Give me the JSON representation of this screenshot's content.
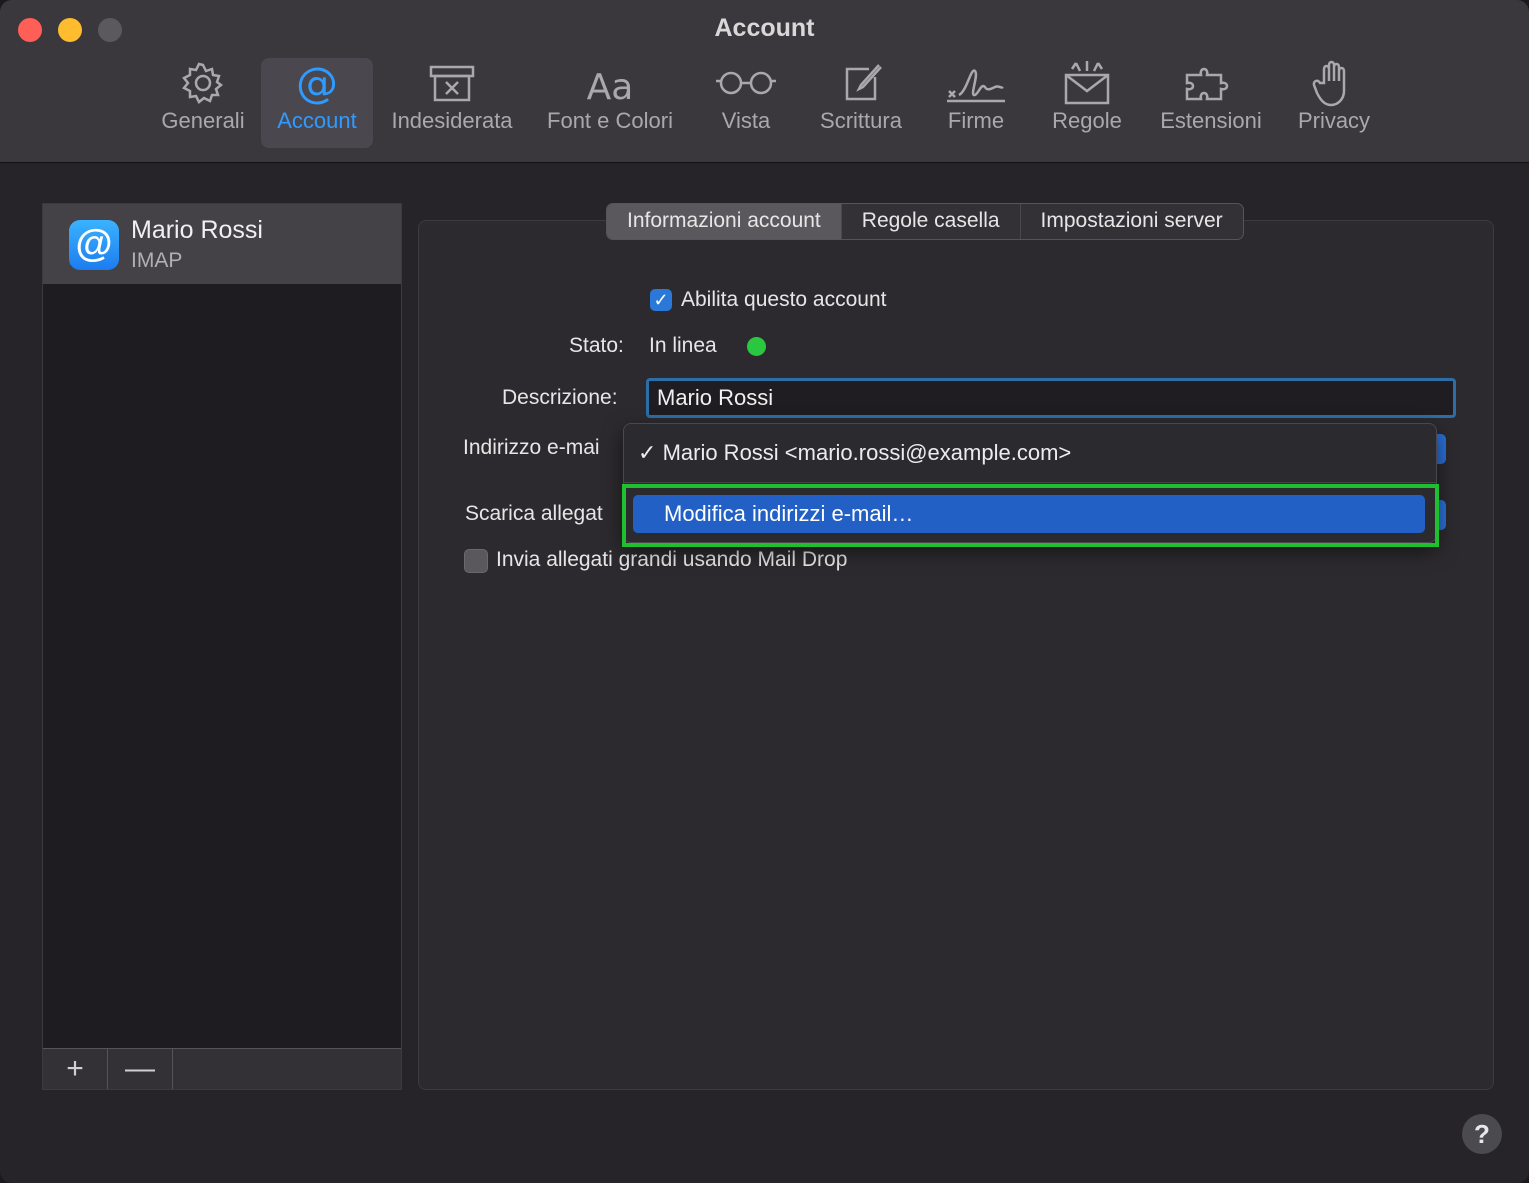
{
  "window": {
    "title": "Account"
  },
  "toolbar": [
    {
      "id": "generali",
      "label": "Generali",
      "icon": "gear-icon"
    },
    {
      "id": "account",
      "label": "Account",
      "icon": "at-icon"
    },
    {
      "id": "indesiderata",
      "label": "Indesiderata",
      "icon": "junk-box-icon"
    },
    {
      "id": "font",
      "label": "Font e Colori",
      "icon": "font-icon"
    },
    {
      "id": "vista",
      "label": "Vista",
      "icon": "glasses-icon"
    },
    {
      "id": "scrittura",
      "label": "Scrittura",
      "icon": "compose-icon"
    },
    {
      "id": "firme",
      "label": "Firme",
      "icon": "signature-icon"
    },
    {
      "id": "regole",
      "label": "Regole",
      "icon": "envelope-rules-icon"
    },
    {
      "id": "estensioni",
      "label": "Estensioni",
      "icon": "puzzle-icon"
    },
    {
      "id": "privacy",
      "label": "Privacy",
      "icon": "hand-icon"
    }
  ],
  "active_tab": "Account",
  "sidebar": {
    "account": {
      "name": "Mario Rossi",
      "type": "IMAP",
      "icon": "@"
    },
    "add_label": "+",
    "remove_label": "—"
  },
  "segments": [
    "Informazioni account",
    "Regole casella",
    "Impostazioni server"
  ],
  "form": {
    "enable_label": "Abilita questo account",
    "enable_checked": true,
    "status_label": "Stato:",
    "status_value": "In linea",
    "description_label": "Descrizione:",
    "description_value": "Mario Rossi",
    "email_label": "Indirizzo e-mai",
    "attachments_label": "Scarica allegat",
    "maildrop_label": "Invia allegati grandi usando Mail Drop",
    "maildrop_checked": false
  },
  "dropdown": {
    "checkmark": "✓",
    "item_selected": "Mario Rossi <mario.rossi@example.com>",
    "item_edit": "Modifica indirizzi e-mail…"
  },
  "help": "?",
  "colors": {
    "accent": "#2f9bff",
    "status_online": "#2ac840",
    "highlight": "#1fbf2f",
    "menu_selection": "#2360c6"
  }
}
